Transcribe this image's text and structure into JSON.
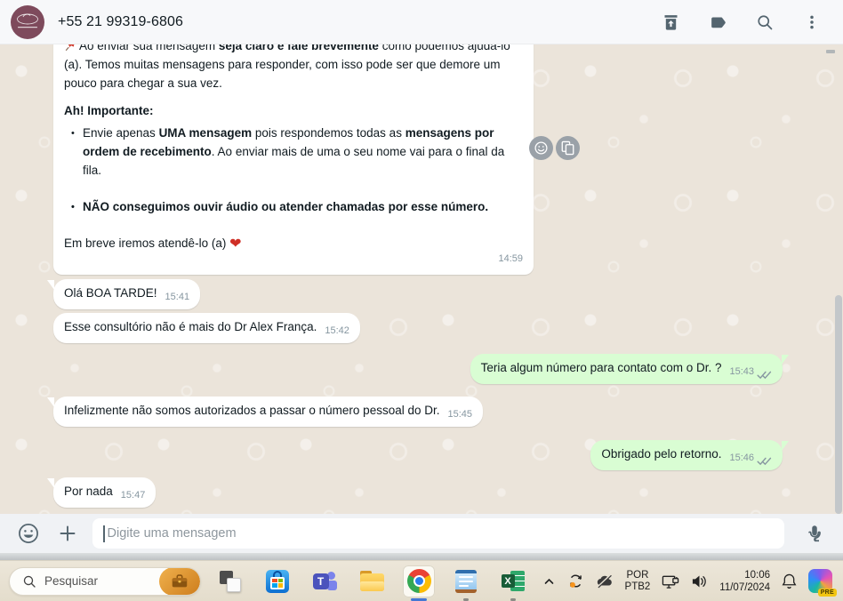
{
  "header": {
    "contact_name": "+55 21 99319-6806",
    "avatar": "business-logo-plum-circle",
    "action_icons": [
      "archive-icon",
      "label-icon",
      "search-icon",
      "menu-icon"
    ]
  },
  "chat": {
    "welcome": {
      "icon": "pushpin-emoji",
      "p1": [
        "Ao enviar sua mensagem ",
        "seja claro e fale brevemente",
        " como podemos ajudá-lo (a). Temos muitas mensagens para responder, com isso pode ser que demore um pouco para chegar a sua vez."
      ],
      "heading": "Ah! Importante:",
      "bullet1": [
        "Envie apenas ",
        "UMA mensagem",
        " pois respondemos todas as ",
        "mensagens por ordem de recebimento",
        ". Ao enviar mais de uma o seu nome vai para o final da fila."
      ],
      "bullet2": "NÃO conseguimos ouvir áudio ou atender chamadas por esse número.",
      "closing": "Em breve iremos atendê-lo (a)",
      "heart": "❤",
      "time": "14:59"
    },
    "messages": [
      {
        "direction": "in",
        "text": "Olá BOA TARDE!",
        "time": "15:41"
      },
      {
        "direction": "in",
        "text": "Esse consultório não é mais do Dr Alex França.",
        "time": "15:42"
      },
      {
        "direction": "out",
        "text": "Teria algum número para contato com o Dr. ?",
        "time": "15:43",
        "status": "delivered-double-check"
      },
      {
        "direction": "in",
        "text": "Infelizmente não somos autorizados a passar o número pessoal do Dr.",
        "time": "15:45"
      },
      {
        "direction": "out",
        "text": "Obrigado pelo retorno.",
        "time": "15:46",
        "status": "delivered-double-check"
      },
      {
        "direction": "in",
        "text": "Por nada",
        "time": "15:47"
      }
    ],
    "hover_action_icons": [
      "react-smiley-icon",
      "copy-icon"
    ]
  },
  "composer": {
    "placeholder": "Digite uma mensagem",
    "icons": [
      "emoji-icon",
      "plus-icon",
      "mic-icon"
    ]
  },
  "taskbar": {
    "search": {
      "placeholder": "Pesquisar",
      "icon": "search-icon",
      "thumbnail": "briefcase-image"
    },
    "apps": [
      "task-view",
      "microsoft-store",
      "teams",
      "file-explorer",
      "chrome",
      "notepad",
      "excel"
    ],
    "active_app": "chrome",
    "running_apps": [
      "notepad",
      "excel"
    ],
    "tray": {
      "language_line1": "POR",
      "language_line2": "PTB2",
      "time": "10:06",
      "date": "11/07/2024",
      "copilot_badge": "PRE",
      "icons": [
        "chevron-up-icon",
        "sync-update-icon",
        "onedrive-paused-icon",
        "network-icon",
        "volume-icon",
        "bell-icon",
        "copilot-icon"
      ]
    }
  },
  "colors": {
    "incoming_bubble": "#ffffff",
    "outgoing_bubble": "#d9fdd3",
    "chat_background": "#ebe4da",
    "check_gray": "#8696a0",
    "avatar_bg": "#7e4a5c",
    "chrome_indicator": "#4477d4",
    "copilot_badge_bg": "#f2c511"
  }
}
